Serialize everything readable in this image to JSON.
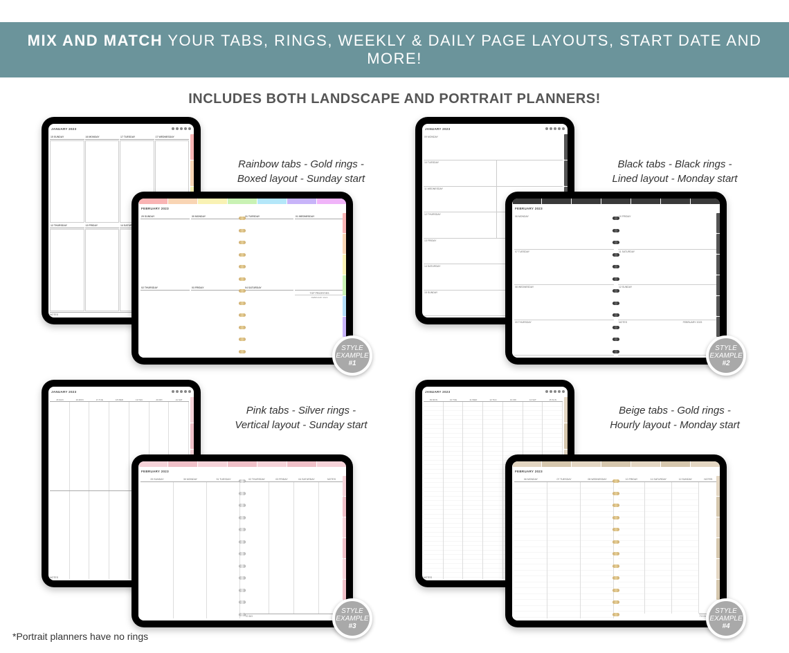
{
  "banner": {
    "bold": "MIX AND MATCH",
    "light": " YOUR TABS, RINGS, WEEKLY & DAILY PAGE LAYOUTS, START DATE AND MORE!"
  },
  "subhead": "INCLUDES BOTH LANDSCAPE AND PORTRAIT PLANNERS!",
  "examples": {
    "e1": {
      "caption_l1": "Rainbow tabs - Gold rings -",
      "caption_l2": "Boxed layout - Sunday start",
      "portrait_month": "JANUARY 2023",
      "landscape_month": "FEBRUARY 2023",
      "badge_l1": "STYLE",
      "badge_l2": "EXAMPLE",
      "badge_num": "#1",
      "days_p": [
        "15 SUNDAY",
        "16 MONDAY",
        "17 TUESDAY",
        "17 WEDNESDAY",
        "12 THURSDAY",
        "13 FRIDAY",
        "14 SATURDAY"
      ],
      "notes": "NOTES",
      "days_l_left": [
        "29 SUNDAY",
        "30 MONDAY",
        "31 TUESDAY",
        "01 WEDNESDAY",
        "02 THURSDAY",
        "03 FRIDAY"
      ],
      "sat": "04 SATURDAY",
      "priorities": "TOP PRIORITIES",
      "mini": "FEBRUARY 2023"
    },
    "e2": {
      "caption_l1": "Black tabs - Black rings -",
      "caption_l2": "Lined layout - Monday start",
      "portrait_month": "JANUARY 2023",
      "landscape_month": "FEBRUARY 2023",
      "badge_l1": "STYLE",
      "badge_l2": "EXAMPLE",
      "badge_num": "#2",
      "days_p": [
        "09 MONDAY",
        "10 TUESDAY",
        "11 WEDNESDAY",
        "12 THURSDAY",
        "13 FRIDAY",
        "14 SATURDAY",
        "15 SUNDAY"
      ],
      "days_l_left": [
        "06 MONDAY",
        "07 TUESDAY",
        "08 WEDNESDAY",
        "09 THURSDAY"
      ],
      "days_l_right": [
        "10 FRIDAY",
        "11 SATURDAY",
        "12 SUNDAY"
      ],
      "notes": "NOTES",
      "mini": "FEBRUARY 2023"
    },
    "e3": {
      "caption_l1": "Pink tabs - Silver rings -",
      "caption_l2": "Vertical layout - Sunday start",
      "portrait_month": "JANUARY 2023",
      "landscape_month": "FEBRUARY 2023",
      "badge_l1": "STYLE",
      "badge_l2": "EXAMPLE",
      "badge_num": "#3",
      "days_short": [
        "15 SUN",
        "16 MON",
        "17 TUE",
        "18 WED",
        "19 THU",
        "20 FRI",
        "21 SAT"
      ],
      "days_l_left": [
        "29 SUNDAY",
        "30 MONDAY",
        "31 TUESDAY"
      ],
      "days_l_right": [
        "02 THURSDAY",
        "03 FRIDAY",
        "04 SATURDAY",
        "NOTES"
      ],
      "notes": "NOTES",
      "todo": "TO DO"
    },
    "e4": {
      "caption_l1": "Beige tabs - Gold rings -",
      "caption_l2": "Hourly layout - Monday start",
      "portrait_month": "JANUARY 2023",
      "landscape_month": "FEBRUARY 2023",
      "badge_l1": "STYLE",
      "badge_l2": "EXAMPLE",
      "badge_num": "#4",
      "days_short": [
        "09 MON",
        "10 TUE",
        "11 WED",
        "12 THU",
        "13 FRI",
        "14 SAT",
        "15 SUN"
      ],
      "days_l_left": [
        "06 MONDAY",
        "07 TUESDAY",
        "08 WEDNESDAY"
      ],
      "days_l_right": [
        "10 FRIDAY",
        "11 SATURDAY",
        "12 SUNDAY",
        "NOTES"
      ],
      "notes": "NOTES",
      "todo": "TO DO"
    }
  },
  "footnote": "*Portrait planners have no rings"
}
